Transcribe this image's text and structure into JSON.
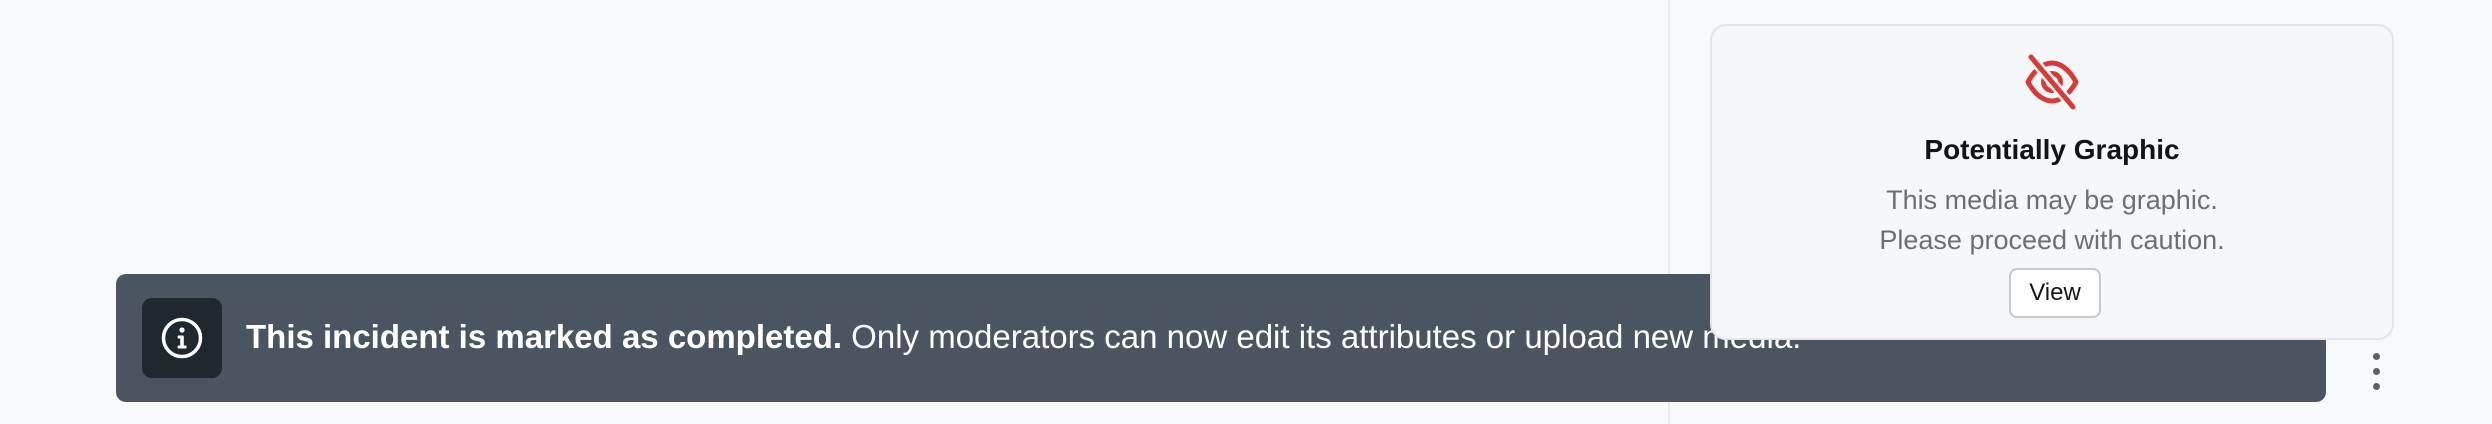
{
  "banner": {
    "icon": "info-icon",
    "bold_text": "This incident is marked as completed.",
    "text": " Only moderators can now edit its attributes or upload new media."
  },
  "media_card": {
    "icon": "eye-slash-icon",
    "icon_color": "#d93a35",
    "title": "Potentially Graphic",
    "description_line1": "This media may be graphic.",
    "description_line2": "Please proceed with caution.",
    "view_label": "View"
  },
  "more_menu": {
    "icon": "vertical-dots-icon"
  },
  "colors": {
    "banner_bg": "#4a5561",
    "banner_icon_bg": "#1f272f",
    "page_bg": "#f8f9fa"
  }
}
